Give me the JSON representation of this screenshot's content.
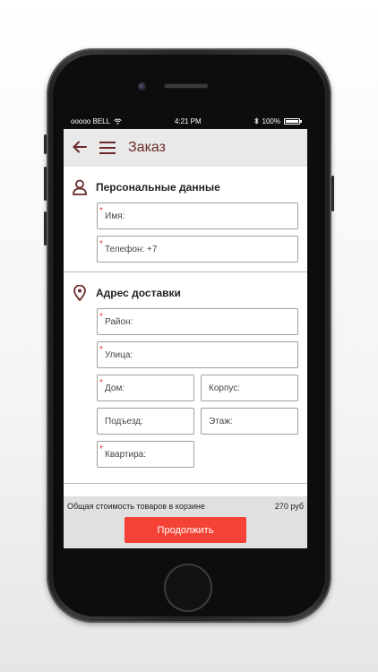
{
  "status": {
    "carrier": "ooooo BELL",
    "time": "4:21 PM",
    "battery": "100%"
  },
  "appbar": {
    "title": "Заказ"
  },
  "personal": {
    "heading": "Персональные данные",
    "name_label": "Имя:",
    "phone_label": "Телефон: +7"
  },
  "address": {
    "heading": "Адрес доставки",
    "district_label": "Район:",
    "street_label": "Улица:",
    "house_label": "Дом:",
    "building_label": "Корпус:",
    "entrance_label": "Подъезд:",
    "floor_label": "Этаж:",
    "apartment_label": "Квартира:"
  },
  "footer": {
    "total_label": "Общая стоимость товаров в корзине",
    "total_value": "270 руб",
    "continue_label": "Продолжить"
  },
  "colors": {
    "accent": "#6b2a2a",
    "button": "#f44336",
    "required": "#e53935"
  },
  "icons": {
    "back": "arrow-left",
    "menu": "hamburger",
    "person": "person-outline",
    "location": "location-pin"
  }
}
